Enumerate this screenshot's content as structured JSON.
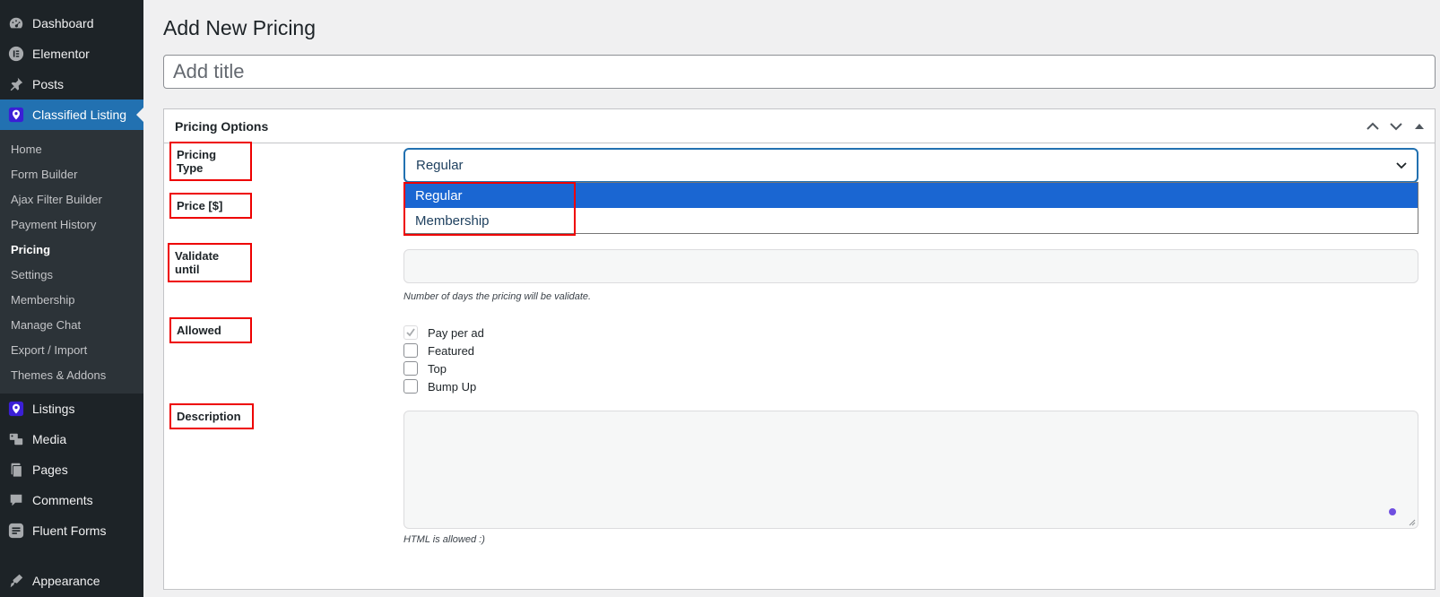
{
  "sidebar": {
    "top_items": [
      {
        "label": "Dashboard",
        "icon": "dashboard-icon"
      },
      {
        "label": "Elementor",
        "icon": "elementor-icon"
      },
      {
        "label": "Posts",
        "icon": "pin-icon"
      },
      {
        "label": "Classified Listing",
        "icon": "classified-listing-icon"
      }
    ],
    "submenu": [
      "Home",
      "Form Builder",
      "Ajax Filter Builder",
      "Payment History",
      "Pricing",
      "Settings",
      "Membership",
      "Manage Chat",
      "Export / Import",
      "Themes & Addons"
    ],
    "active_submenu": "Pricing",
    "bottom_items": [
      {
        "label": "Listings",
        "icon": "listings-icon"
      },
      {
        "label": "Media",
        "icon": "media-icon"
      },
      {
        "label": "Pages",
        "icon": "pages-icon"
      },
      {
        "label": "Comments",
        "icon": "comments-icon"
      },
      {
        "label": "Fluent Forms",
        "icon": "fluent-forms-icon"
      },
      {
        "label": "Appearance",
        "icon": "appearance-icon"
      }
    ]
  },
  "main": {
    "page_title": "Add New Pricing",
    "title_placeholder": "Add title",
    "postbox_title": "Pricing Options",
    "fields": {
      "pricing_type_label": "Pricing Type",
      "price_label": "Price [$]",
      "validate_label": "Validate until",
      "allowed_label": "Allowed",
      "description_label": "Description"
    },
    "pricing_type": {
      "selected": "Regular",
      "options": [
        "Regular",
        "Membership"
      ]
    },
    "validate_hint": "Number of days the pricing will be validate.",
    "allowed_options": [
      {
        "label": "Pay per ad",
        "checked": true
      },
      {
        "label": "Featured",
        "checked": false
      },
      {
        "label": "Top",
        "checked": false
      },
      {
        "label": "Bump Up",
        "checked": false
      }
    ],
    "description_hint": "HTML is allowed :)"
  },
  "colors": {
    "sidebar_bg": "#1d2327",
    "accent": "#2271b1",
    "dropdown_selected": "#1a66d2",
    "highlight": "#e00000"
  }
}
